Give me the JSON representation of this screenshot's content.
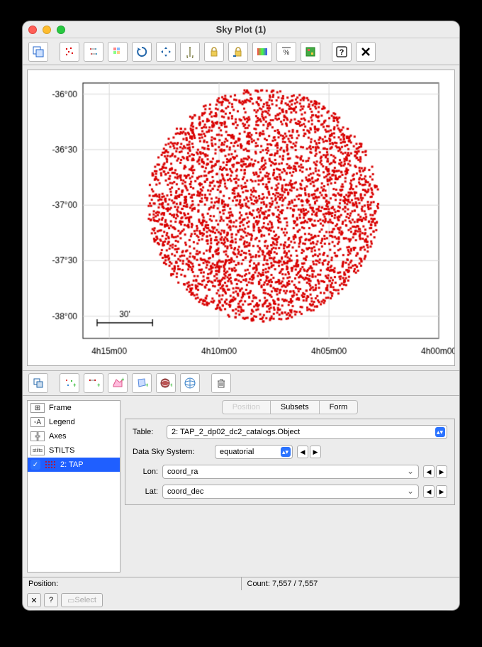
{
  "window": {
    "title": "Sky Plot (1)"
  },
  "chart_data": {
    "type": "scatter",
    "title": "",
    "xlabel": "",
    "ylabel": "",
    "x_axis": {
      "type": "ra_hours",
      "ticks": [
        "4h15m00",
        "4h10m00",
        "4h05m00",
        "4h00m00"
      ],
      "range_hours": [
        4.0,
        4.27
      ]
    },
    "y_axis": {
      "type": "dec_deg",
      "ticks": [
        "-36°00",
        "-36°30",
        "-37°00",
        "-37°30",
        "-38°00"
      ],
      "range_deg": [
        -38.2,
        -35.9
      ]
    },
    "scale_bar": "30'",
    "series": [
      {
        "name": "2: TAP",
        "color": "#d90000",
        "marker": "square",
        "n_points": 7557,
        "distribution": "uniform-disc",
        "center_ra_h": 4.133,
        "center_dec_deg": -37.0,
        "radius_deg": 1.05
      }
    ],
    "note": "Individual point coordinates not enumerable from raster; described by distribution parameters above."
  },
  "tree": {
    "items": [
      {
        "label": "Frame"
      },
      {
        "label": "Legend"
      },
      {
        "label": "Axes"
      },
      {
        "label": "STILTS"
      },
      {
        "label": "2: TAP",
        "selected": true,
        "checked": true
      }
    ]
  },
  "tabs": {
    "items": [
      "Position",
      "Subsets",
      "Form"
    ],
    "active": 0
  },
  "form": {
    "table_label": "Table:",
    "table_value": "2: TAP_2_dp02_dc2_catalogs.Object",
    "sky_label": "Data Sky System:",
    "sky_value": "equatorial",
    "lon_label": "Lon:",
    "lon_value": "coord_ra",
    "lat_label": "Lat:",
    "lat_value": "coord_dec"
  },
  "status": {
    "position_label": "Position:",
    "count_label": "Count:",
    "count_value": "7,557 / 7,557",
    "select_label": "Select"
  }
}
